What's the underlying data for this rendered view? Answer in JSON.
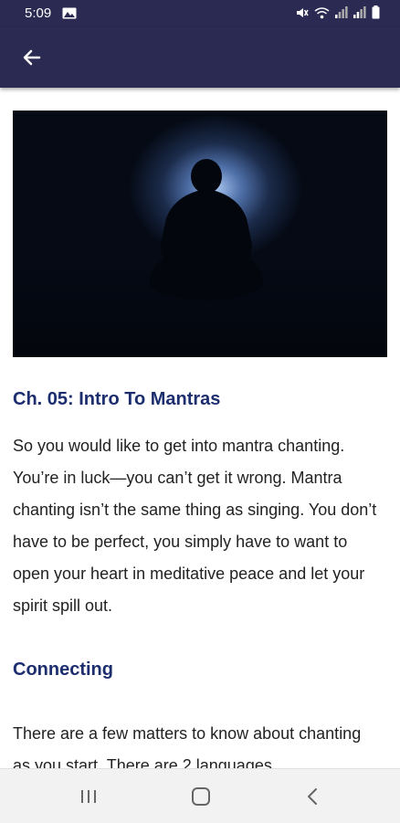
{
  "status_bar": {
    "time": "5:09",
    "icons": [
      "gallery-icon",
      "mute-icon",
      "wifi-icon",
      "signal-icon",
      "signal-icon",
      "battery-icon"
    ]
  },
  "app_bar": {
    "back_icon": "arrow-left-icon",
    "background_color": "#2a2a52"
  },
  "article": {
    "image": "meditating-silhouette-image",
    "chapter_title": "Ch. 05: Intro To Mantras",
    "intro_paragraph": "So you would like to get into mantra chanting. You’re in luck—you can’t get it wrong. Mantra chanting isn’t the same thing as singing. You don’t have to be perfect, you simply have to want to open your heart in meditative peace and let your spirit spill out.",
    "section_heading": "Connecting",
    "section_paragraph": "There are a few matters to know about chanting as you start. There are 2 languages",
    "heading_color": "#1c2e6e"
  },
  "nav_bar": {
    "icons": [
      "recent-apps-icon",
      "home-icon",
      "back-icon"
    ]
  }
}
